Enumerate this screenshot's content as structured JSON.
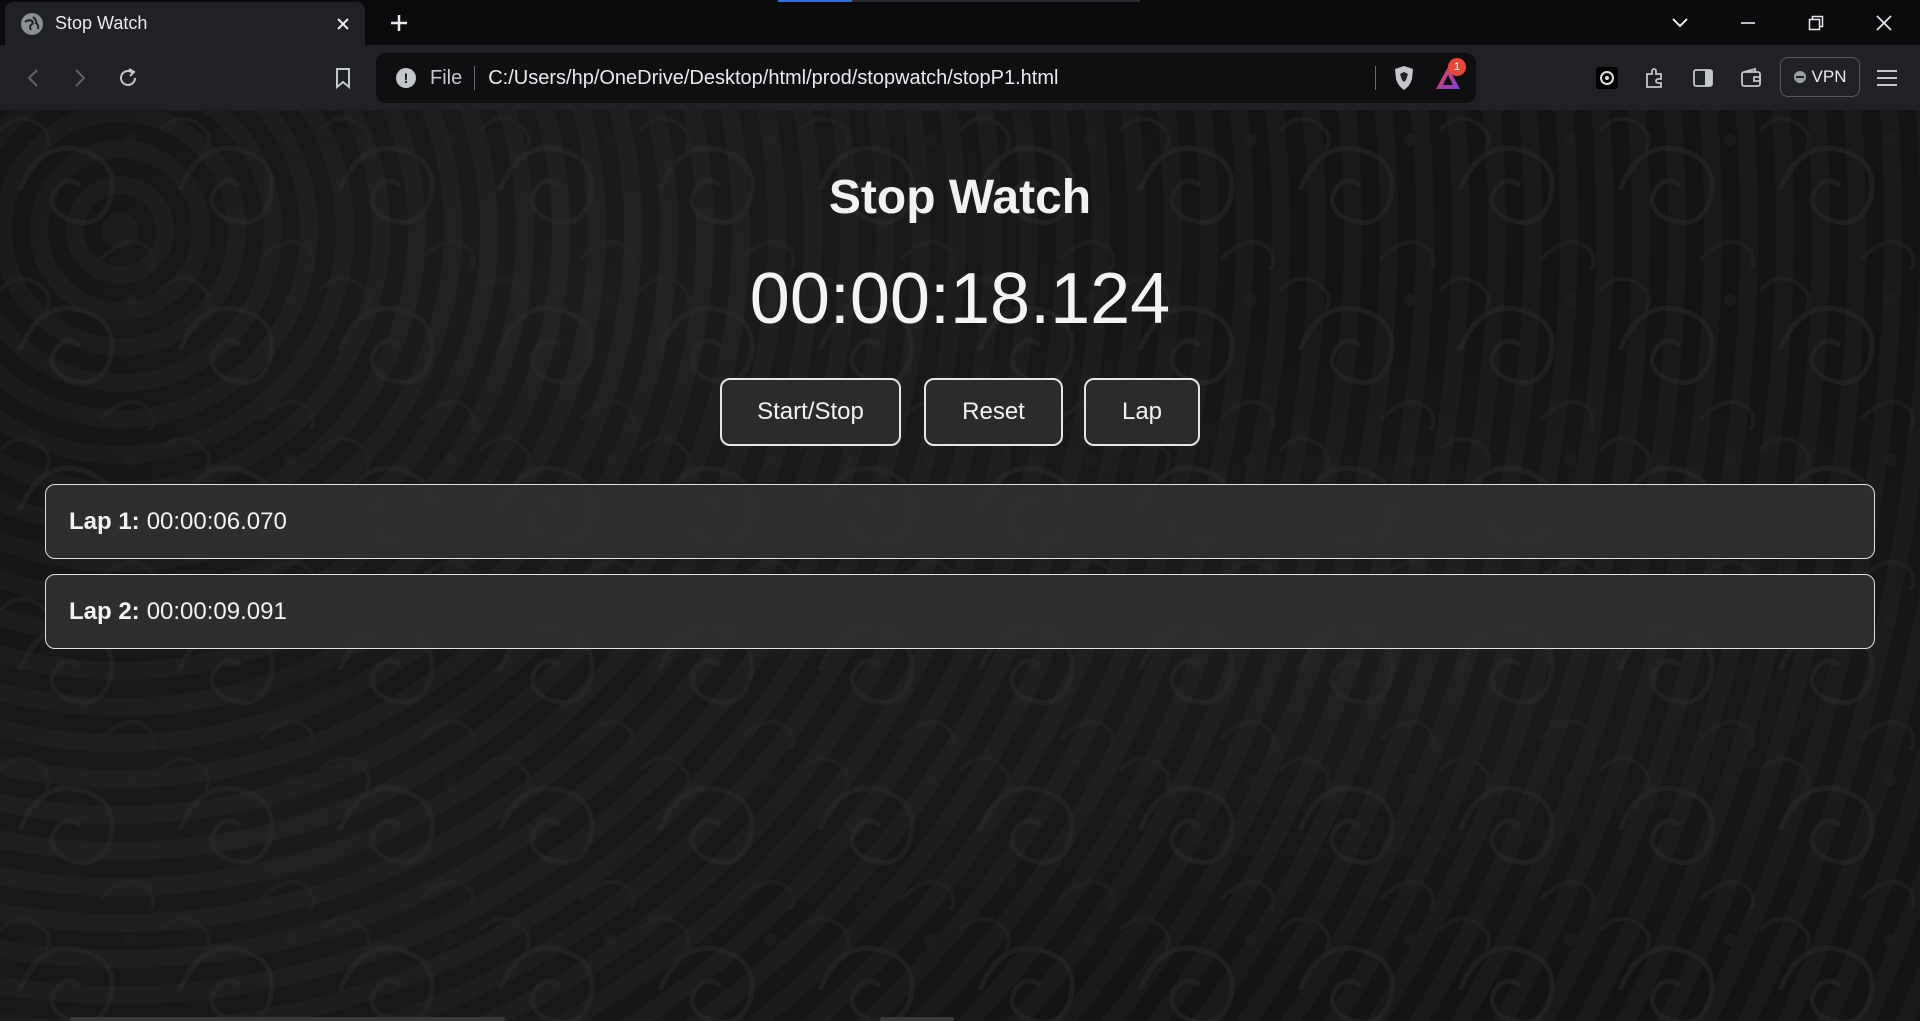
{
  "browser": {
    "tab_title": "Stop Watch",
    "omnibox": {
      "scheme": "File",
      "url": "C:/Users/hp/OneDrive/Desktop/html/prod/stopwatch/stopP1.html",
      "rewards_badge": "1"
    },
    "vpn_label": "VPN"
  },
  "page": {
    "heading": "Stop Watch",
    "timer": "00:00:18.124",
    "buttons": {
      "start_stop": "Start/Stop",
      "reset": "Reset",
      "lap": "Lap"
    },
    "laps": [
      {
        "label": "Lap 1:",
        "time": "00:00:06.070"
      },
      {
        "label": "Lap 2:",
        "time": "00:00:09.091"
      }
    ]
  },
  "colors": {
    "page_bg": "#151516",
    "toolbar_bg": "#202124",
    "accent_blue": "#2f6de1",
    "badge_red": "#e5483b"
  }
}
